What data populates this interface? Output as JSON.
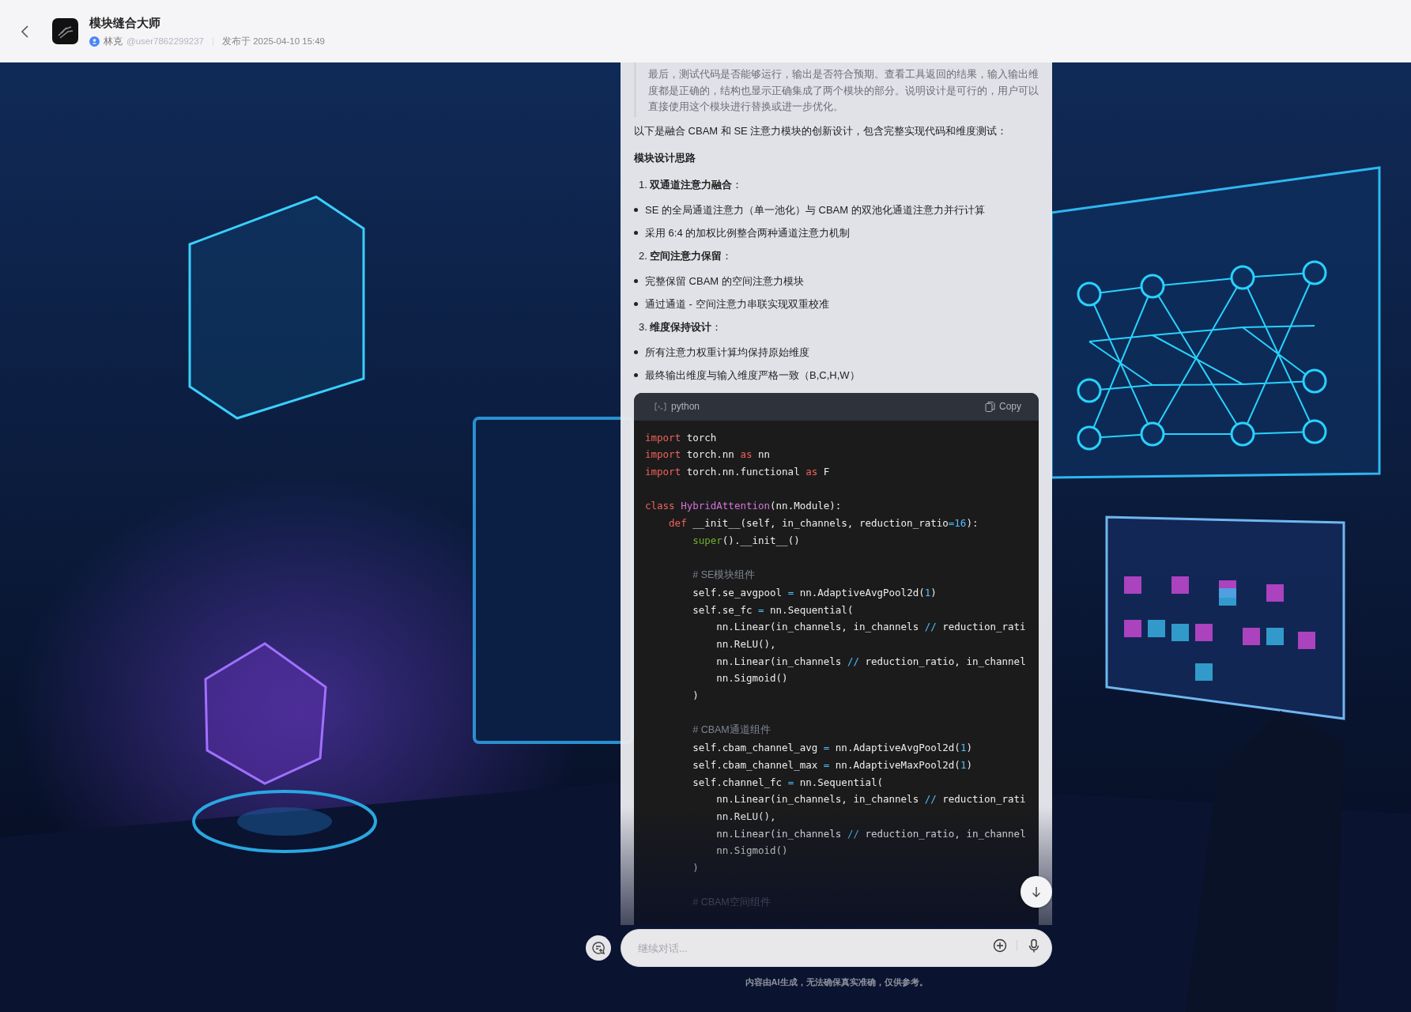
{
  "header": {
    "title": "模块缝合大师",
    "author": "林克",
    "handle": "@user7862299237",
    "published": "发布于 2025-04-10 15:49"
  },
  "message": {
    "quote": "最后，测试代码是否能够运行，输出是否符合预期。查看工具返回的结果，输入输出维度都是正确的，结构也显示正确集成了两个模块的部分。说明设计是可行的，用户可以直接使用这个模块进行替换或进一步优化。",
    "blocks": [
      {
        "kind": "paragraph",
        "text": "以下是融合 CBAM 和 SE 注意力模块的创新设计，包含完整实现代码和维度测试："
      },
      {
        "kind": "heading",
        "text": "模块设计思路"
      },
      {
        "kind": "numbered",
        "text": "1. **双通道注意力融合**："
      },
      {
        "kind": "bullet",
        "text": "SE 的全局通道注意力（单一池化）与 CBAM 的双池化通道注意力并行计算"
      },
      {
        "kind": "bullet",
        "text": "采用 6:4 的加权比例整合两种通道注意力机制"
      },
      {
        "kind": "numbered",
        "text": "2. **空间注意力保留**："
      },
      {
        "kind": "bullet",
        "text": "完整保留 CBAM 的空间注意力模块"
      },
      {
        "kind": "bullet",
        "text": "通过通道 - 空间注意力串联实现双重校准"
      },
      {
        "kind": "numbered",
        "text": "3. **维度保持设计**："
      },
      {
        "kind": "bullet",
        "text": "所有注意力权重计算均保持原始维度"
      },
      {
        "kind": "bullet",
        "text": "最终输出维度与输入维度严格一致（B,C,H,W）"
      }
    ],
    "code": {
      "language": "python",
      "copy_label": "Copy",
      "lines": [
        {
          "kind": "code",
          "tokens": [
            {
              "kind": "kw",
              "t": "import"
            },
            {
              "kind": "p",
              "t": " torch"
            }
          ]
        },
        {
          "kind": "code",
          "tokens": [
            {
              "kind": "kw",
              "t": "import"
            },
            {
              "kind": "p",
              "t": " torch.nn "
            },
            {
              "kind": "kw",
              "t": "as"
            },
            {
              "kind": "p",
              "t": " nn"
            }
          ]
        },
        {
          "kind": "code",
          "tokens": [
            {
              "kind": "kw",
              "t": "import"
            },
            {
              "kind": "p",
              "t": " torch.nn.functional "
            },
            {
              "kind": "kw",
              "t": "as"
            },
            {
              "kind": "p",
              "t": " F"
            }
          ]
        },
        {
          "kind": "blank"
        },
        {
          "kind": "code",
          "tokens": [
            {
              "kind": "kw",
              "t": "class"
            },
            {
              "kind": "cls",
              "t": " HybridAttention"
            },
            {
              "kind": "p",
              "t": "(nn.Module):"
            }
          ],
          "children": [
            {
              "kind": "code",
              "tokens": [
                {
                  "kind": "kw",
                  "t": "def"
                },
                {
                  "kind": "p",
                  "t": " __init__(self, in_channels, reduction_ratio"
                },
                {
                  "kind": "op",
                  "t": "="
                },
                {
                  "kind": "num",
                  "t": "16"
                },
                {
                  "kind": "p",
                  "t": "):"
                }
              ],
              "children": [
                {
                  "kind": "code",
                  "tokens": [
                    {
                      "kind": "fn",
                      "t": "super"
                    },
                    {
                      "kind": "p",
                      "t": "().__init__()"
                    }
                  ]
                },
                {
                  "kind": "blank"
                },
                {
                  "kind": "code",
                  "tokens": [
                    {
                      "kind": "cmt",
                      "t": "# SE模块组件"
                    }
                  ]
                },
                {
                  "kind": "code",
                  "tokens": [
                    {
                      "kind": "p",
                      "t": "self.se_avgpool "
                    },
                    {
                      "kind": "op",
                      "t": "="
                    },
                    {
                      "kind": "p",
                      "t": " nn.AdaptiveAvgPool2d("
                    },
                    {
                      "kind": "num",
                      "t": "1"
                    },
                    {
                      "kind": "p",
                      "t": ")"
                    }
                  ]
                },
                {
                  "kind": "code",
                  "tokens": [
                    {
                      "kind": "p",
                      "t": "self.se_fc "
                    },
                    {
                      "kind": "op",
                      "t": "="
                    },
                    {
                      "kind": "p",
                      "t": " nn.Sequential("
                    }
                  ],
                  "children": [
                    {
                      "kind": "code",
                      "tokens": [
                        {
                          "kind": "p",
                          "t": "nn.Linear(in_channels, in_channels "
                        },
                        {
                          "kind": "op",
                          "t": "//"
                        },
                        {
                          "kind": "p",
                          "t": " reduction_rati"
                        }
                      ]
                    },
                    {
                      "kind": "code",
                      "tokens": [
                        {
                          "kind": "p",
                          "t": "nn.ReLU(),"
                        }
                      ]
                    },
                    {
                      "kind": "code",
                      "tokens": [
                        {
                          "kind": "p",
                          "t": "nn.Linear(in_channels "
                        },
                        {
                          "kind": "op",
                          "t": "//"
                        },
                        {
                          "kind": "p",
                          "t": " reduction_ratio, in_channel"
                        }
                      ]
                    },
                    {
                      "kind": "code",
                      "tokens": [
                        {
                          "kind": "p",
                          "t": "nn.Sigmoid()"
                        }
                      ]
                    }
                  ]
                },
                {
                  "kind": "code",
                  "tokens": [
                    {
                      "kind": "p",
                      "t": ")"
                    }
                  ]
                },
                {
                  "kind": "blank"
                },
                {
                  "kind": "code",
                  "tokens": [
                    {
                      "kind": "cmt",
                      "t": "# CBAM通道组件"
                    }
                  ]
                },
                {
                  "kind": "code",
                  "tokens": [
                    {
                      "kind": "p",
                      "t": "self.cbam_channel_avg "
                    },
                    {
                      "kind": "op",
                      "t": "="
                    },
                    {
                      "kind": "p",
                      "t": " nn.AdaptiveAvgPool2d("
                    },
                    {
                      "kind": "num",
                      "t": "1"
                    },
                    {
                      "kind": "p",
                      "t": ")"
                    }
                  ]
                },
                {
                  "kind": "code",
                  "tokens": [
                    {
                      "kind": "p",
                      "t": "self.cbam_channel_max "
                    },
                    {
                      "kind": "op",
                      "t": "="
                    },
                    {
                      "kind": "p",
                      "t": " nn.AdaptiveMaxPool2d("
                    },
                    {
                      "kind": "num",
                      "t": "1"
                    },
                    {
                      "kind": "p",
                      "t": ")"
                    }
                  ]
                },
                {
                  "kind": "code",
                  "tokens": [
                    {
                      "kind": "p",
                      "t": "self.channel_fc "
                    },
                    {
                      "kind": "op",
                      "t": "="
                    },
                    {
                      "kind": "p",
                      "t": " nn.Sequential("
                    }
                  ],
                  "children": [
                    {
                      "kind": "code",
                      "tokens": [
                        {
                          "kind": "p",
                          "t": "nn.Linear(in_channels, in_channels "
                        },
                        {
                          "kind": "op",
                          "t": "//"
                        },
                        {
                          "kind": "p",
                          "t": " reduction_rati"
                        }
                      ]
                    },
                    {
                      "kind": "code",
                      "tokens": [
                        {
                          "kind": "p",
                          "t": "nn.ReLU(),"
                        }
                      ]
                    },
                    {
                      "kind": "code",
                      "tokens": [
                        {
                          "kind": "p",
                          "t": "nn.Linear(in_channels "
                        },
                        {
                          "kind": "op",
                          "t": "//"
                        },
                        {
                          "kind": "p",
                          "t": " reduction_ratio, in_channel"
                        }
                      ]
                    },
                    {
                      "kind": "code",
                      "tokens": [
                        {
                          "kind": "p",
                          "t": "nn.Sigmoid()"
                        }
                      ]
                    }
                  ]
                },
                {
                  "kind": "code",
                  "tokens": [
                    {
                      "kind": "p",
                      "t": ")"
                    }
                  ]
                },
                {
                  "kind": "blank"
                },
                {
                  "kind": "code",
                  "tokens": [
                    {
                      "kind": "cmt",
                      "t": "# CBAM空间组件"
                    }
                  ]
                }
              ]
            }
          ]
        }
      ]
    }
  },
  "composer": {
    "placeholder": "继续对话..."
  },
  "disclaimer": "内容由AI生成，无法确保真实准确，仅供参考。"
}
